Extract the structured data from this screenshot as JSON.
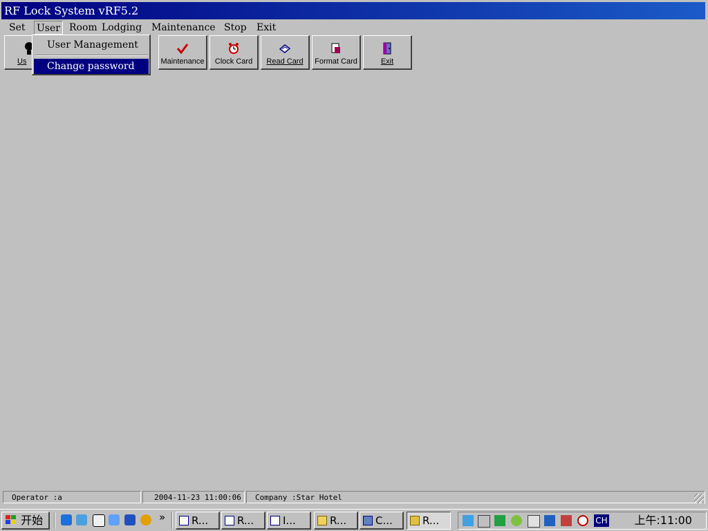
{
  "window": {
    "title": "RF Lock System vRF5.2"
  },
  "menubar": {
    "items": [
      {
        "label": "Set"
      },
      {
        "label": "User"
      },
      {
        "label": "Room"
      },
      {
        "label": "Lodging"
      },
      {
        "label": "Maintenance"
      },
      {
        "label": "Stop"
      },
      {
        "label": "Exit"
      }
    ]
  },
  "user_menu": {
    "items": [
      {
        "label": "User Management"
      },
      {
        "label": "Change password"
      }
    ]
  },
  "toolbar": {
    "buttons": [
      {
        "label": "Us",
        "icon": "user-icon"
      },
      {
        "label": "Maintenance",
        "icon": "checkmark-icon"
      },
      {
        "label": "Clock Card",
        "icon": "alarm-clock-icon"
      },
      {
        "label": "Read Card",
        "icon": "card-icon"
      },
      {
        "label": "Format Card",
        "icon": "format-card-icon"
      },
      {
        "label": "Exit",
        "icon": "exit-door-icon"
      }
    ]
  },
  "statusbar": {
    "operator": "Operator :a",
    "datetime": "2004-11-23 11:00:06",
    "company": "Company :Star Hotel"
  },
  "taskbar": {
    "start_label": "开始",
    "quicklaunch_more": "»",
    "tasks": [
      {
        "label": "R..."
      },
      {
        "label": "R..."
      },
      {
        "label": "I..."
      },
      {
        "label": "R..."
      },
      {
        "label": "C..."
      },
      {
        "label": "R..."
      }
    ],
    "language": "CH",
    "clock": "上午:11:00"
  },
  "colors": {
    "face": "#c0c0c0",
    "title_start": "#000080",
    "title_end": "#1b5bc8",
    "selection": "#000080",
    "check_red": "#cc0000"
  }
}
